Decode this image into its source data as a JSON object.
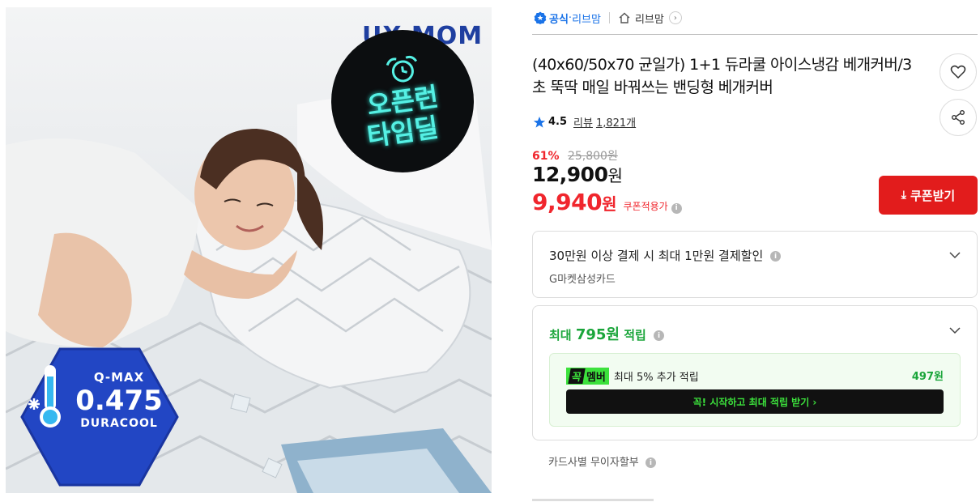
{
  "image": {
    "brand_text": "UX MOM",
    "badge_line1": "오픈런",
    "badge_line2": "타임딜",
    "badge_icon": "alarm-clock-icon",
    "hex_q": "Q-MAX",
    "hex_value": "0.475",
    "hex_sub": "DURACOOL",
    "hex_icon": "thermometer-snowflake-icon",
    "colors": {
      "badge_text": "#55f0e4",
      "hex_fill": "#2246c4"
    }
  },
  "seller": {
    "official_label": "공식",
    "dot": "·",
    "seller_name": "리브맘",
    "shop_name": "리브맘",
    "official_icon": "verified-badge-icon",
    "home_icon": "home-icon",
    "chevron": "›"
  },
  "product": {
    "title": "(40x60/50x70 균일가) 1+1 듀라쿨 아이스냉감 베개커버/3초 뚝딱 매일 바꿔쓰는 밴딩형 베개커버",
    "rating": "4.5",
    "review_label": "리뷰",
    "review_count": "1,821개"
  },
  "price": {
    "discount_pct": "61%",
    "original": "25,800원",
    "sale_value": "12,900",
    "sale_unit": "원",
    "coupon_value": "9,940",
    "coupon_unit": "원",
    "coupon_label": "쿠폰적용가",
    "coupon_button": "쿠폰받기",
    "accent": "#f0262d"
  },
  "benefits": {
    "card_discount_main": "30만원 이상 결제 시 최대 1만원 결제할인",
    "card_discount_sub": "G마켓삼성카드",
    "points_prefix": "최대",
    "points_amount": "795원",
    "points_suffix": "적립",
    "member_tag_k": "꼭",
    "member_tag": "멤버",
    "member_desc": "최대 5% 추가 적립",
    "member_points": "497원",
    "member_cta": "꼭! 시작하고 최대 적립 받기 ›",
    "installment": "카드사별 무이자할부",
    "green": "#1aa53a"
  }
}
